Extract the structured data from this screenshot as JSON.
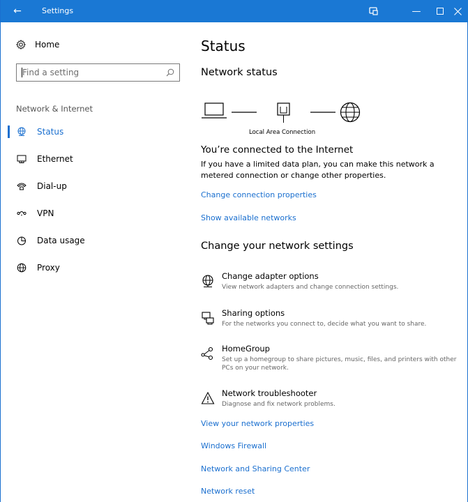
{
  "window": {
    "title": "Settings",
    "accent": "#1a78d4"
  },
  "sidebar": {
    "home_label": "Home",
    "search_placeholder": "Find a setting",
    "section_label": "Network & Internet",
    "items": [
      {
        "label": "Status",
        "icon": "globe-status-icon",
        "active": true
      },
      {
        "label": "Ethernet",
        "icon": "ethernet-icon",
        "active": false
      },
      {
        "label": "Dial-up",
        "icon": "dialup-icon",
        "active": false
      },
      {
        "label": "VPN",
        "icon": "vpn-icon",
        "active": false
      },
      {
        "label": "Data usage",
        "icon": "data-usage-icon",
        "active": false
      },
      {
        "label": "Proxy",
        "icon": "globe-icon",
        "active": false
      }
    ]
  },
  "main": {
    "title": "Status",
    "network_status_heading": "Network status",
    "connection_name": "Local Area Connection",
    "connected_text": "You’re connected to the Internet",
    "connected_desc": "If you have a limited data plan, you can make this network a metered connection or change other properties.",
    "links_top": {
      "change_properties": "Change connection properties",
      "show_networks": "Show available networks"
    },
    "change_settings_heading": "Change your network settings",
    "options": [
      {
        "title": "Change adapter options",
        "desc": "View network adapters and change connection settings.",
        "icon": "adapter-icon"
      },
      {
        "title": "Sharing options",
        "desc": "For the networks you connect to, decide what you want to share.",
        "icon": "sharing-icon"
      },
      {
        "title": "HomeGroup",
        "desc": "Set up a homegroup to share pictures, music, files, and printers with other PCs on your network.",
        "icon": "homegroup-icon"
      },
      {
        "title": "Network troubleshooter",
        "desc": "Diagnose and fix network problems.",
        "icon": "warning-icon"
      }
    ],
    "links_bottom": {
      "view_properties": "View your network properties",
      "firewall": "Windows Firewall",
      "sharing_center": "Network and Sharing Center",
      "reset": "Network reset"
    }
  }
}
